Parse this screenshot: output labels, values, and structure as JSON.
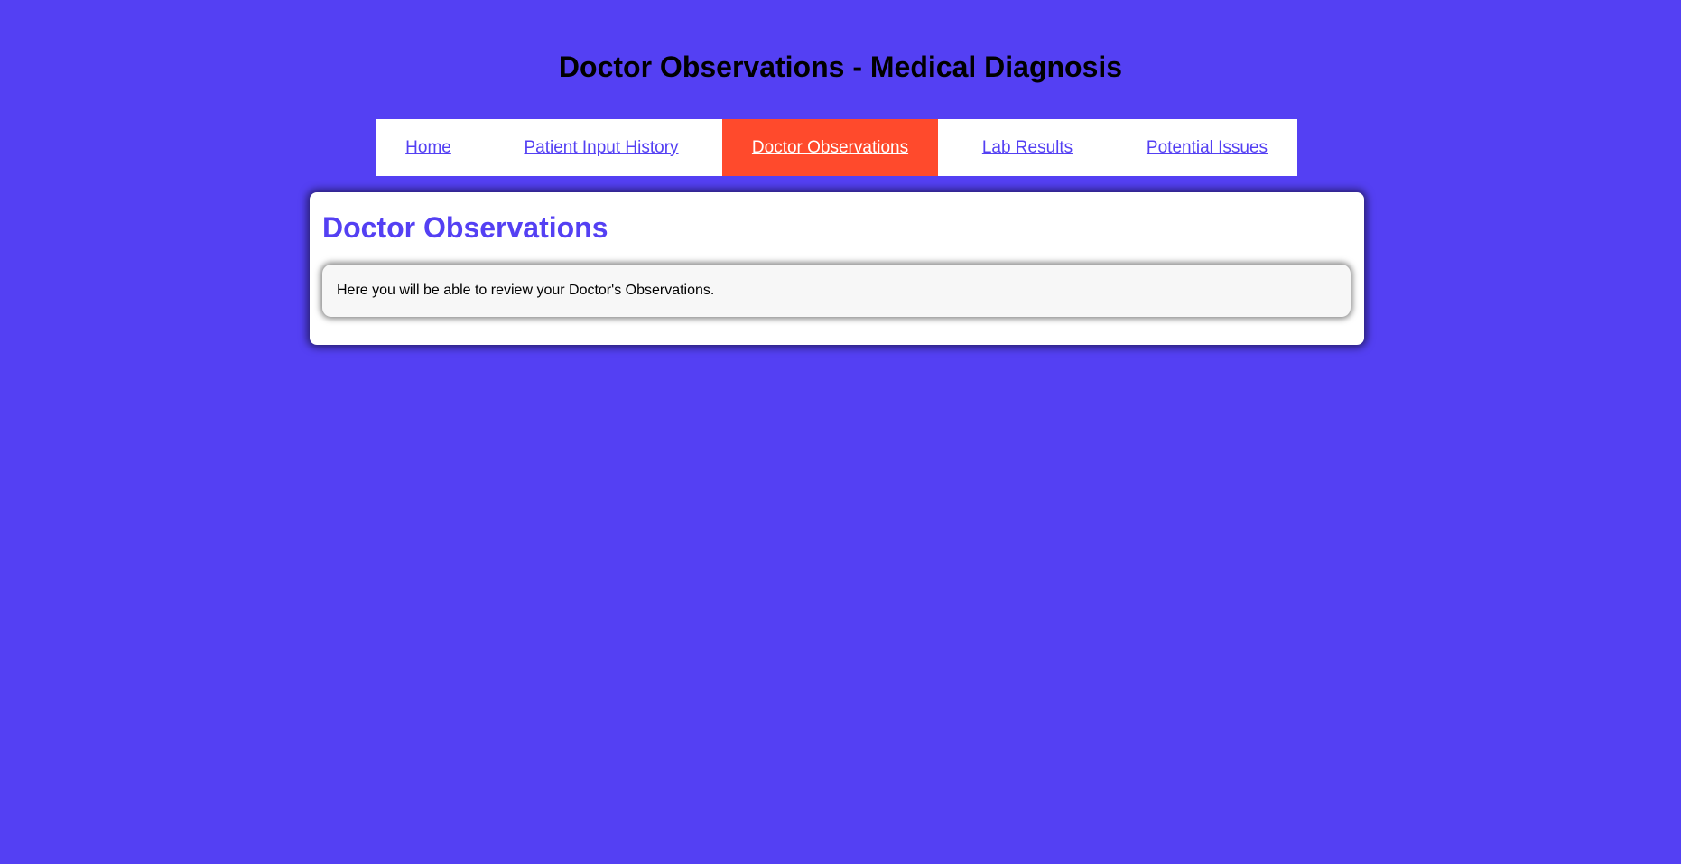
{
  "header": {
    "title": "Doctor Observations - Medical Diagnosis"
  },
  "nav": {
    "items": [
      {
        "label": "Home",
        "active": false
      },
      {
        "label": "Patient Input History",
        "active": false
      },
      {
        "label": "Doctor Observations",
        "active": true
      },
      {
        "label": "Lab Results",
        "active": false
      },
      {
        "label": "Potential Issues",
        "active": false
      }
    ]
  },
  "main": {
    "heading": "Doctor Observations",
    "info_text": "Here you will be able to review your Doctor's Observations."
  },
  "colors": {
    "background": "#5440f3",
    "accent": "#ff4a2c",
    "link": "#5440f3"
  }
}
